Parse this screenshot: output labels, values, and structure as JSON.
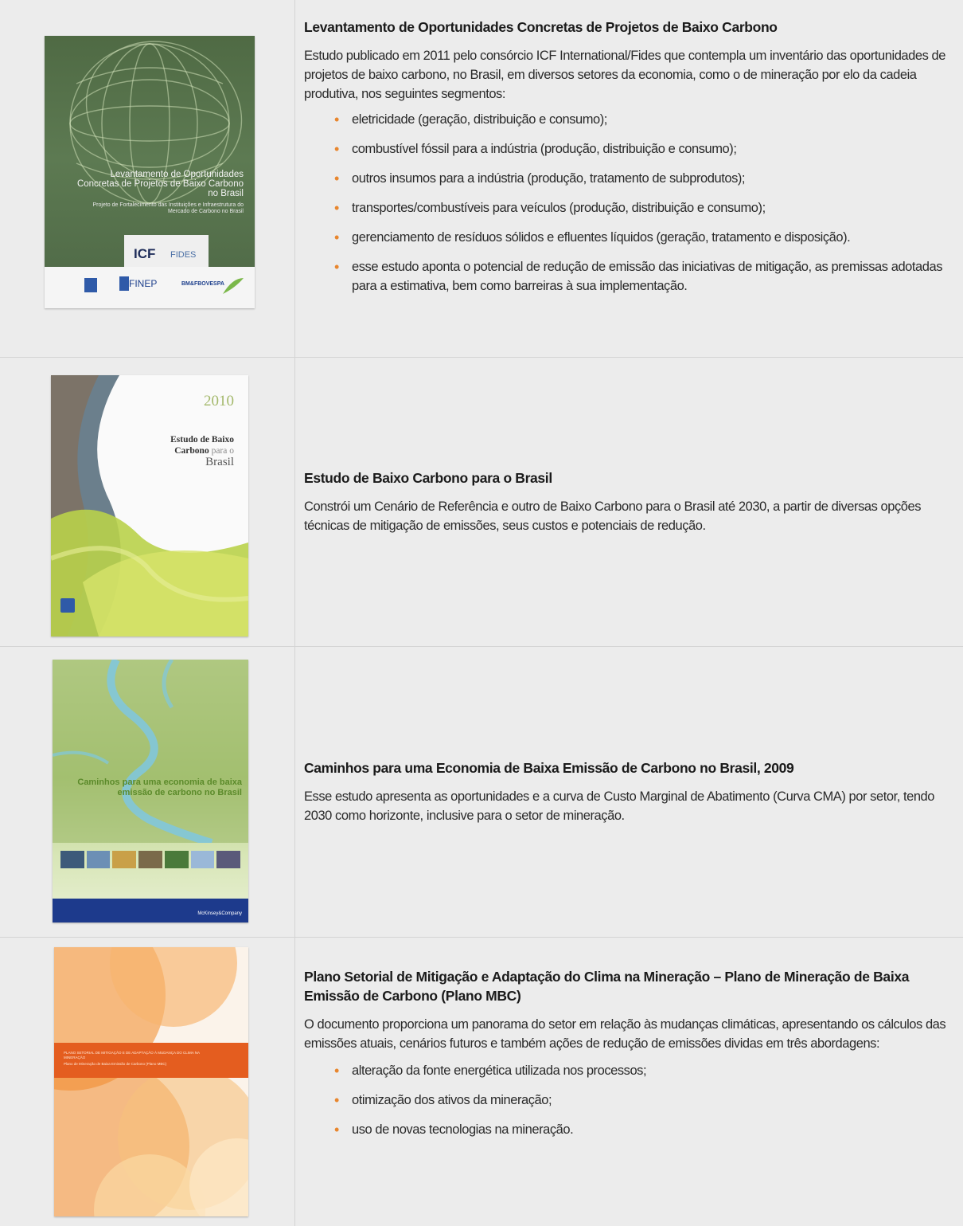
{
  "rows": [
    {
      "title": "Levantamento de Oportunidades Concretas de Projetos de Baixo Carbono",
      "text": "Estudo publicado em 2011 pelo consórcio ICF International/Fides que contempla um inventário das oportunidades de projetos de baixo carbono, no Brasil, em diversos setores da economia, como o de mineração por elo da cadeia produtiva, nos seguintes segmentos:",
      "bullets": [
        "eletricidade (geração, distribuição e consumo);",
        "combustível fóssil para a indústria (produção, distribuição e consumo);",
        "outros insumos para a indústria (produção, tratamento de subprodutos);",
        "transportes/combustíveis para veículos (produção, distribuição e consumo);",
        "gerenciamento de resíduos sólidos e efluentes líquidos (geração, tratamento e disposição).",
        "esse estudo aponta o potencial de redução de emissão das iniciativas de mitigação, as premissas adotadas para a estimativa, bem como barreiras à sua implementação."
      ],
      "cover": {
        "title": "Levantamento de Oportunidades Concretas de Projetos de Baixo Carbono no Brasil",
        "subtitle": "Projeto de Fortalecimento das Instituições e Infraestrutura do Mercado de Carbono no Brasil",
        "logo_icf": "ICF",
        "logo_fides": "FIDES",
        "logo_finep": "FINEP",
        "logo_bmf": "BM&FBOVESPA"
      }
    },
    {
      "title": "Estudo de Baixo Carbono para o Brasil",
      "text": "Constrói um Cenário de Referência e outro de Baixo Carbono para o Brasil até 2030, a partir de diversas opções técnicas de mitigação de emissões, seus custos e potenciais de redução.",
      "cover": {
        "year": "2010",
        "title_a": "Estudo de Baixo",
        "title_b": "Carbono",
        "title_c": "para o",
        "title_d": "Brasil"
      }
    },
    {
      "title": "Caminhos para uma Economia de Baixa Emissão de Carbono no Brasil, 2009",
      "text": "Esse estudo apresenta as oportunidades e a curva de Custo Marginal de Abatimento (Curva CMA) por setor, tendo 2030 como horizonte, inclusive para o setor de mineração.",
      "cover": {
        "title": "Caminhos para uma economia de baixa emissão de carbono no Brasil",
        "publisher": "McKinsey&Company"
      }
    },
    {
      "title": "Plano Setorial de Mitigação e Adaptação do Clima na Mineração – Plano de Mineração de Baixa Emissão de Carbono (Plano MBC)",
      "text": "O documento proporciona um panorama do setor em relação às mudanças climáticas, apresentando os cálculos das emissões atuais, cenários futuros e também ações de redução de emissões dividas em três abordagens:",
      "bullets": [
        "alteração da fonte energética utilizada nos processos;",
        "otimização dos ativos da mineração;",
        "uso de novas tecnologias na mineração."
      ],
      "cover": {
        "title": "PLANO SETORIAL DE MITIGAÇÃO E DE ADAPTAÇÃO À MUDANÇA DO CLIMA NA MINERAÇÃO",
        "subtitle": "Plano de Mineração de Baixa Emissão de Carbono (Plano MBC)"
      }
    }
  ]
}
